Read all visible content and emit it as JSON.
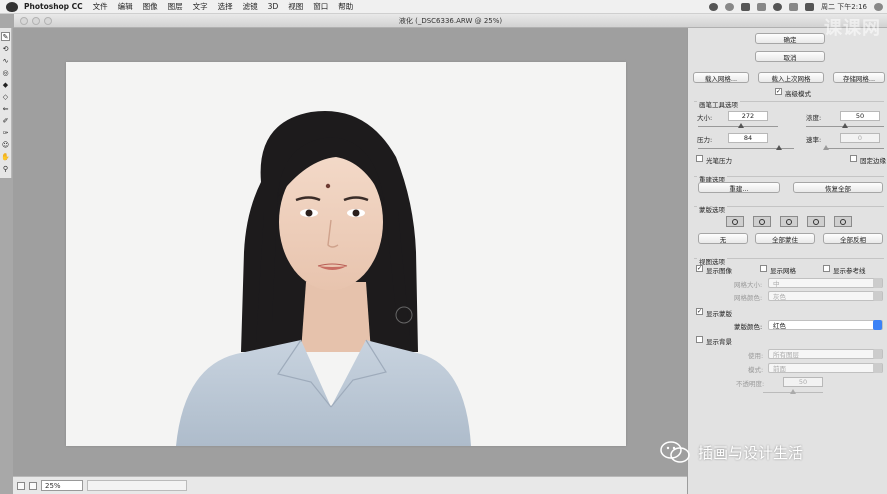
{
  "menubar": {
    "app_name": "Photoshop CC",
    "items": [
      "文件",
      "编辑",
      "图像",
      "图层",
      "文字",
      "选择",
      "滤镜",
      "3D",
      "视图",
      "窗口",
      "帮助"
    ],
    "clock": "周二 下午2:16"
  },
  "window": {
    "title": "液化 (_DSC6336.ARW @ 25%)"
  },
  "statusbar": {
    "zoom": "25%"
  },
  "panel": {
    "ok": "确定",
    "cancel": "取消",
    "load_mesh": "载入网格...",
    "load_last_mesh": "载入上次网格",
    "save_mesh": "存储网格...",
    "advanced_mode": "高级模式",
    "brush_options": {
      "title": "画笔工具选项",
      "size_label": "大小:",
      "size_value": "272",
      "density_label": "浓度:",
      "density_value": "50",
      "pressure_label": "压力:",
      "pressure_value": "84",
      "rate_label": "速率:",
      "rate_value": "0",
      "stylus_pressure": "光笔压力",
      "pin_edges": "固定边缘"
    },
    "reconstruct": {
      "title": "重建选项",
      "reconstruct_btn": "重建...",
      "restore_all_btn": "恢复全部"
    },
    "mask": {
      "title": "蒙版选项",
      "none_btn": "无",
      "mask_all_btn": "全部蒙住",
      "invert_all_btn": "全部反相"
    },
    "view": {
      "title": "视图选项",
      "show_image": "显示图像",
      "show_mesh": "显示网格",
      "show_guides": "显示参考线",
      "mesh_size_label": "网格大小:",
      "mesh_size_value": "中",
      "mesh_color_label": "网格颜色:",
      "mesh_color_value": "灰色",
      "show_mask": "显示蒙版",
      "mask_color_label": "蒙版颜色:",
      "mask_color_value": "红色",
      "show_backdrop": "显示背景",
      "use_label": "使用:",
      "use_value": "所有图层",
      "mode_label": "模式:",
      "mode_value": "前面",
      "opacity_label": "不透明度:",
      "opacity_value": "50"
    }
  },
  "overlay": {
    "watermark": "课课网",
    "wechat_caption": "插画与设计生活"
  }
}
